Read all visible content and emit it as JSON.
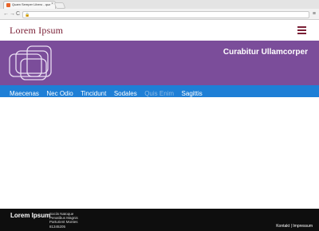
{
  "browser": {
    "tab_title": "Quam Semper Libero - qua...",
    "tab_close": "×",
    "back": "←",
    "forward": "→",
    "reload": "C",
    "url_value": "",
    "url_icon": "🔒",
    "menu": "≡"
  },
  "header": {
    "title": "Lorem Ipsum",
    "menu_icon": "hamburger-icon",
    "brand_color": "#7a2036"
  },
  "banner": {
    "title": "Curabitur Ullamcorper",
    "background": "#7b4d9a"
  },
  "nav": {
    "items": [
      {
        "label": "Maecenas"
      },
      {
        "label": "Nec Odio"
      },
      {
        "label": "Tincidunt"
      },
      {
        "label": "Sodales"
      },
      {
        "label": "Quis Enim"
      },
      {
        "label": "Sagittis"
      }
    ],
    "active_index": 4,
    "background": "#1e7fd6"
  },
  "footer": {
    "title": "Lorem Ipsum",
    "address": [
      "Sociis Natoque",
      "Penatibus Magnis",
      "Parturient Montes",
      "81345205"
    ],
    "kontakt": "Kontakt",
    "separator": "|",
    "impressum": "Impressum"
  }
}
